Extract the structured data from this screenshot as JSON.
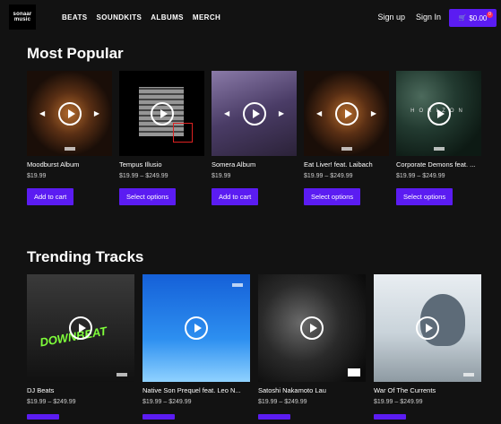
{
  "header": {
    "logo_text": "sonaar music",
    "nav": [
      "BEATS",
      "SOUNDKITS",
      "ALBUMS",
      "MERCH"
    ],
    "sign_up": "Sign up",
    "sign_in": "Sign In",
    "cart_total": "$0.00",
    "cart_count": "0"
  },
  "most_popular": {
    "heading": "Most Popular",
    "items": [
      {
        "title": "Moodburst Album",
        "price": "$19.99",
        "button": "Add to cart"
      },
      {
        "title": "Tempus Illusio",
        "price": "$19.99 – $249.99",
        "button": "Select options"
      },
      {
        "title": "Somera Album",
        "price": "$19.99",
        "button": "Add to cart"
      },
      {
        "title": "Eat Liver! feat. Laibach",
        "price": "$19.99 – $249.99",
        "button": "Select options"
      },
      {
        "title": "Corporate Demons feat. ...",
        "price": "$19.99 – $249.99",
        "button": "Select options",
        "art_text": "HORIZON"
      }
    ]
  },
  "trending": {
    "heading": "Trending Tracks",
    "items": [
      {
        "title": "DJ Beats",
        "price": "$19.99 – $249.99",
        "art_text": "DOWNBEAT"
      },
      {
        "title": "Native Son Prequel feat. Leo N...",
        "price": "$19.99 – $249.99"
      },
      {
        "title": "Satoshi Nakamoto Lau",
        "price": "$19.99 – $249.99"
      },
      {
        "title": "War Of The Currents",
        "price": "$19.99 – $249.99"
      }
    ]
  }
}
